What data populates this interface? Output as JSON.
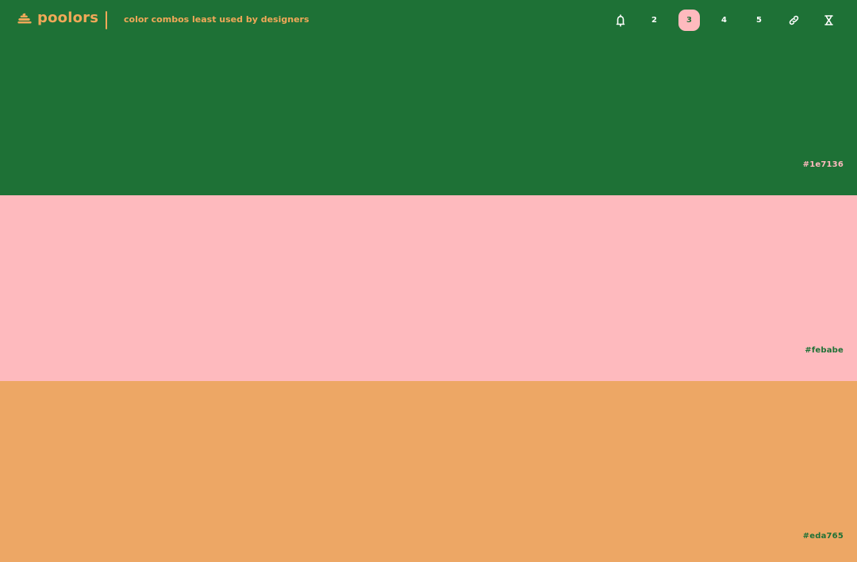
{
  "app": {
    "name": "poolors",
    "tagline": "color combos least used by designers"
  },
  "colors": {
    "header_accent": "#f0a858",
    "divider": "#f0a858",
    "selected_button_bg": "#febabe",
    "selected_button_text": "#1e7136",
    "nav_text": "#ffffff"
  },
  "nav": {
    "count_options": [
      {
        "label": "2",
        "selected": false
      },
      {
        "label": "3",
        "selected": true
      },
      {
        "label": "4",
        "selected": false
      },
      {
        "label": "5",
        "selected": false
      }
    ],
    "icons": {
      "lock": "lock-icon",
      "link": "link-icon",
      "shuffle": "shuffle-icon"
    }
  },
  "palette": [
    {
      "hex": "#1e7136",
      "label": "#1e7136",
      "label_color": "#febabe"
    },
    {
      "hex": "#febabe",
      "label": "#febabe",
      "label_color": "#1e7136"
    },
    {
      "hex": "#eda765",
      "label": "#eda765",
      "label_color": "#1e7136"
    }
  ]
}
